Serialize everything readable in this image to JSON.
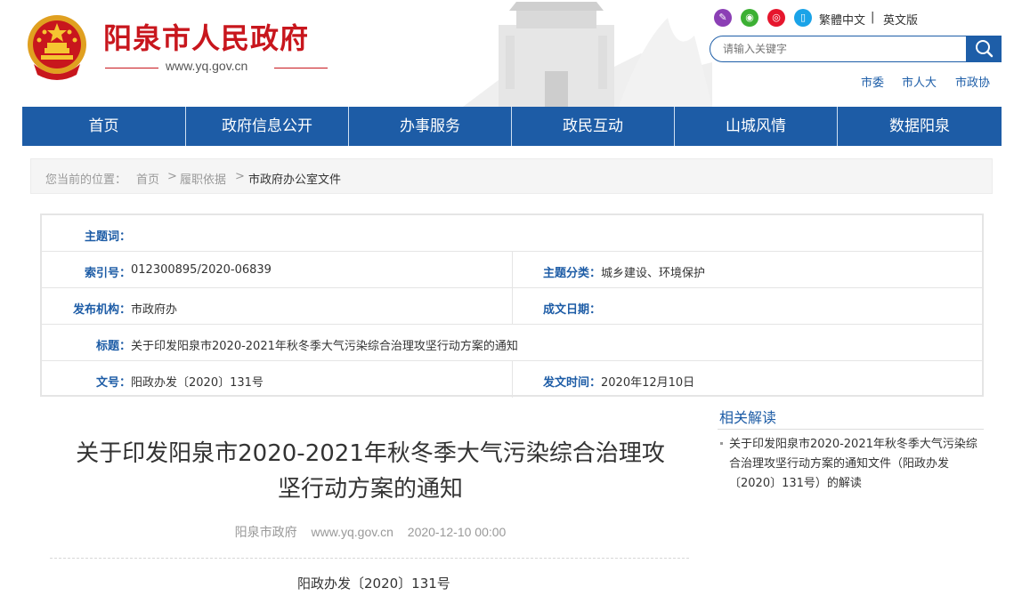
{
  "header": {
    "site_title": "阳泉市人民政府",
    "site_url": "www.yq.gov.cn",
    "emblem": "national-emblem-icon",
    "social_icons": [
      "edit-icon",
      "wechat-icon",
      "weibo-icon",
      "mobile-icon"
    ],
    "lang_traditional": "繁體中文",
    "lang_separator": "|",
    "lang_english": "英文版",
    "search_placeholder": "请输入关键字",
    "quick_links": [
      "市委",
      "市人大",
      "市政协"
    ]
  },
  "nav": {
    "items": [
      "首页",
      "政府信息公开",
      "办事服务",
      "政民互动",
      "山城风情",
      "数据阳泉"
    ]
  },
  "breadcrumb": {
    "prefix": "您当前的位置：",
    "items": [
      "首页",
      "履职依据",
      "市政府办公室文件"
    ],
    "separator": ">"
  },
  "info": {
    "topic_label": "主题词：",
    "topic_value": "",
    "index_label": "索引号：",
    "index_value": "012300895/2020-06839",
    "category_label": "主题分类：",
    "category_value": "城乡建设、环境保护",
    "publisher_label": "发布机构：",
    "publisher_value": "市政府办",
    "created_label": "成文日期：",
    "created_value": "",
    "title_label": "标题：",
    "title_value": "关于印发阳泉市2020-2021年秋冬季大气污染综合治理攻坚行动方案的通知",
    "docno_label": "文号：",
    "docno_value": "阳政办发〔2020〕131号",
    "pubtime_label": "发文时间：",
    "pubtime_value": "2020年12月10日"
  },
  "article": {
    "title_line1": "关于印发阳泉市2020-2021年秋冬季大气污染综合治理攻",
    "title_line2": "坚行动方案的通知",
    "source": "阳泉市政府",
    "site": "www.yq.gov.cn",
    "date": "2020-12-10 00:00",
    "doc_no": "阳政办发〔2020〕131号"
  },
  "sidebar": {
    "title": "相关解读",
    "items": [
      "关于印发阳泉市2020-2021年秋冬季大气污染综合治理攻坚行动方案的通知文件（阳政办发〔2020〕131号）的解读"
    ]
  },
  "colors": {
    "brand_red": "#c8161d",
    "nav_blue": "#1d5ca6",
    "label_blue": "#1d5ca6"
  }
}
